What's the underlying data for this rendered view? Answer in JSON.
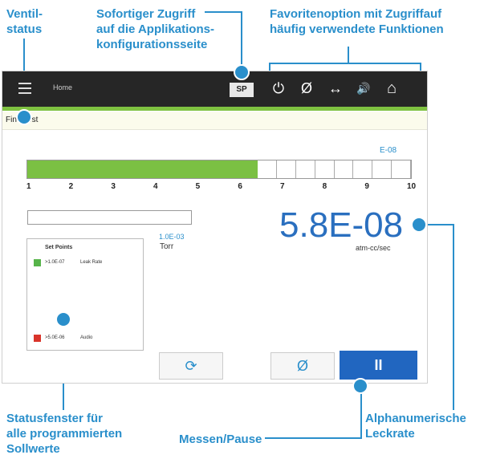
{
  "annotations": {
    "ventil": [
      "Ventil-",
      "status"
    ],
    "zugriff": [
      "Sofortiger Zugriff",
      "auf die Applikations-",
      "konfigurationsseite"
    ],
    "favoriten": [
      "Favoritenoption mit Zugriffauf",
      "häufig verwendete Funktionen"
    ],
    "statusfenster": [
      "Statusfenster für",
      "alle programmierten",
      "Sollwerte"
    ],
    "messen": "Messen/Pause",
    "alpha": [
      "Alphanumerische",
      "Leckrate"
    ]
  },
  "topbar": {
    "menu_icon": "menu-icon",
    "title": "Home",
    "sp_label": "SP",
    "icons": {
      "power": "⏻",
      "zero": "Ø",
      "arrows": "↔",
      "speaker": "🔊",
      "home": "⌂"
    }
  },
  "subtitle": "Fine Test",
  "bar": {
    "exponent": "E-08",
    "fill_fraction": 0.58,
    "segments": 20,
    "ticks": [
      "1",
      "2",
      "3",
      "4",
      "5",
      "6",
      "7",
      "8",
      "9",
      "10"
    ]
  },
  "pressure": {
    "value": "1.0E-03",
    "unit": "Torr"
  },
  "leak_rate": {
    "value": "5.8E-08",
    "unit": "atm-cc/sec"
  },
  "setpoints": {
    "title": "Set Points",
    "items": [
      {
        "color": "#57b44a",
        "value": ">1.0E-07",
        "label": "Leak Rate"
      },
      {
        "color": "#d9342a",
        "value": ">5.0E-06",
        "label": "Audio"
      }
    ]
  },
  "controls": {
    "refresh": "⟳",
    "zero": "Ø",
    "pause": "II"
  },
  "colors": {
    "annotation": "#2a8fcb",
    "accent_green": "#7fc241",
    "pause_blue": "#2166c0",
    "value_blue": "#2a6fbf"
  }
}
